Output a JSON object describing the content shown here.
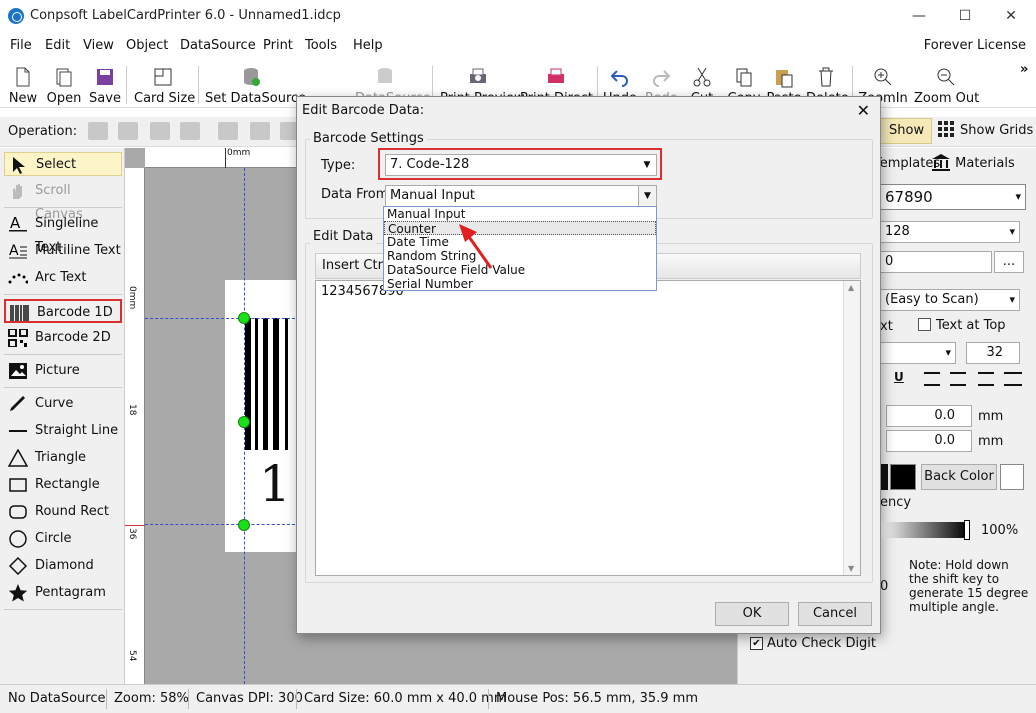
{
  "window": {
    "title": "Conpsoft LabelCardPrinter 6.0 - Unnamed1.idcp",
    "minimize": "—",
    "maximize": "☐",
    "close": "✕"
  },
  "menu": {
    "items": [
      "File",
      "Edit",
      "View",
      "Object",
      "DataSource",
      "Print",
      "Tools",
      "Help"
    ],
    "license": "Forever License"
  },
  "toolbar": {
    "new": "New",
    "open": "Open",
    "save": "Save",
    "card_size": "Card Size",
    "set_datasource": "Set DataSource",
    "datasource": "DataSource",
    "print_preview": "Print Preview",
    "print_direct": "Print Direct",
    "undo": "Undo",
    "redo": "Redo",
    "cut": "Cut",
    "copy": "Copy",
    "paste": "Paste",
    "delete": "Delete",
    "zoom_in": "ZoomIn",
    "zoom_out": "Zoom Out",
    "more": "»"
  },
  "opbar": {
    "label": "Operation:",
    "show_guides": "Show Guides",
    "show_grids": "Show Grids"
  },
  "tools": {
    "select": "Select",
    "scroll_canvas": "Scroll Canvas",
    "singleline_text": "Singleline Text",
    "multiline_text": "Multiline Text",
    "arc_text": "Arc Text",
    "barcode_1d": "Barcode 1D",
    "barcode_2d": "Barcode 2D",
    "picture": "Picture",
    "curve": "Curve",
    "straight_line": "Straight Line",
    "triangle": "Triangle",
    "rectangle": "Rectangle",
    "round_rect": "Round Rect",
    "circle": "Circle",
    "diamond": "Diamond",
    "pentagram": "Pentagram"
  },
  "ruler": {
    "h0": "0mm",
    "v0": "0mm",
    "v18": "18",
    "v36": "36",
    "v54": "54"
  },
  "canvas": {
    "barcode_text": "1:"
  },
  "right": {
    "tab_templates": "Templates",
    "tab_materials": "Materials",
    "barcode_value": "67890",
    "type_value": "128",
    "datafrom_value": "0",
    "more": "...",
    "readability": "(Easy to Scan)",
    "ext": "xt",
    "text_at_top": "Text at Top",
    "font_size": "32",
    "font_underline": "U",
    "x_value": "0.0",
    "y_value": "0.0",
    "unit1": "mm",
    "unit2": "mm",
    "back_color": "Back Color",
    "transparency_label": "ency",
    "transparency_value": "100%",
    "zero": "0",
    "note": "Note: Hold down the shift key to generate 15 degree multiple angle.",
    "auto_check_digit": "Auto Check Digit"
  },
  "status": {
    "datasource": "No DataSource",
    "zoom": "Zoom: 58%",
    "dpi": "Canvas DPI: 300",
    "card_size": "Card Size: 60.0 mm x 40.0 mm",
    "mouse_pos": "Mouse Pos: 56.5 mm, 35.9 mm"
  },
  "dialog": {
    "title": "Edit Barcode Data:",
    "close": "✕",
    "settings_group": "Barcode Settings",
    "type_label": "Type:",
    "type_value": "7.  Code-128",
    "datafrom_label": "Data From:",
    "datafrom_value": "Manual Input",
    "options": [
      "Manual Input",
      "Counter",
      "Date Time",
      "Random String",
      "DataSource Field Value",
      "Serial Number"
    ],
    "highlighted_index": 1,
    "edit_group": "Edit Data",
    "insert_ctrl": "Insert Ctrl C",
    "data_value": "1234567890",
    "ok": "OK",
    "cancel": "Cancel"
  },
  "colors": {
    "accent_red": "#d83030",
    "handle_green": "#19e019",
    "guides_bg": "#f5e9b8"
  }
}
